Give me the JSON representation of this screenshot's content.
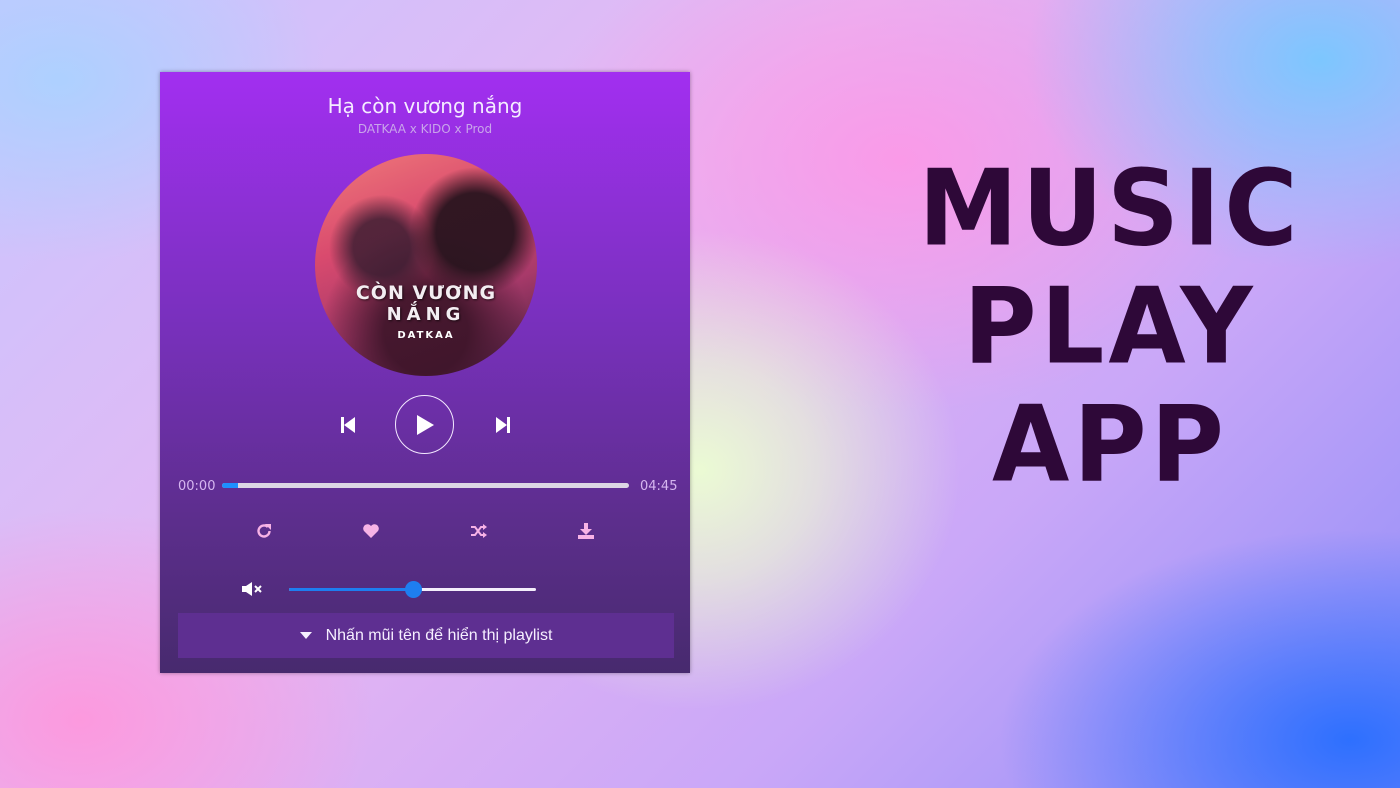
{
  "player": {
    "song_title": "Hạ còn vương nắng",
    "song_artist": "DATKAA x KIDO x Prod",
    "cover": {
      "text_line1": "CÒN VƯƠNG",
      "text_line2": "NẮNG",
      "text_line3": "DATKAA"
    },
    "controls": {
      "prev_icon": "skip-previous-icon",
      "play_icon": "play-icon",
      "next_icon": "skip-next-icon"
    },
    "current_time": "00:00",
    "duration": "04:45",
    "progress_percent": 4,
    "actions": [
      "repeat-icon",
      "heart-icon",
      "shuffle-icon",
      "download-icon"
    ],
    "volume_percent": 50,
    "volume_icon": "mute-icon",
    "playlist_label": "Nhấn mũi tên để hiển thị playlist"
  },
  "headline": {
    "line1": "MUSIC",
    "line2": "PLAY",
    "line3": "APP"
  },
  "colors": {
    "headline": "#2e0838",
    "accent": "#1e8fff",
    "icon_pink": "#f7b3e6"
  }
}
